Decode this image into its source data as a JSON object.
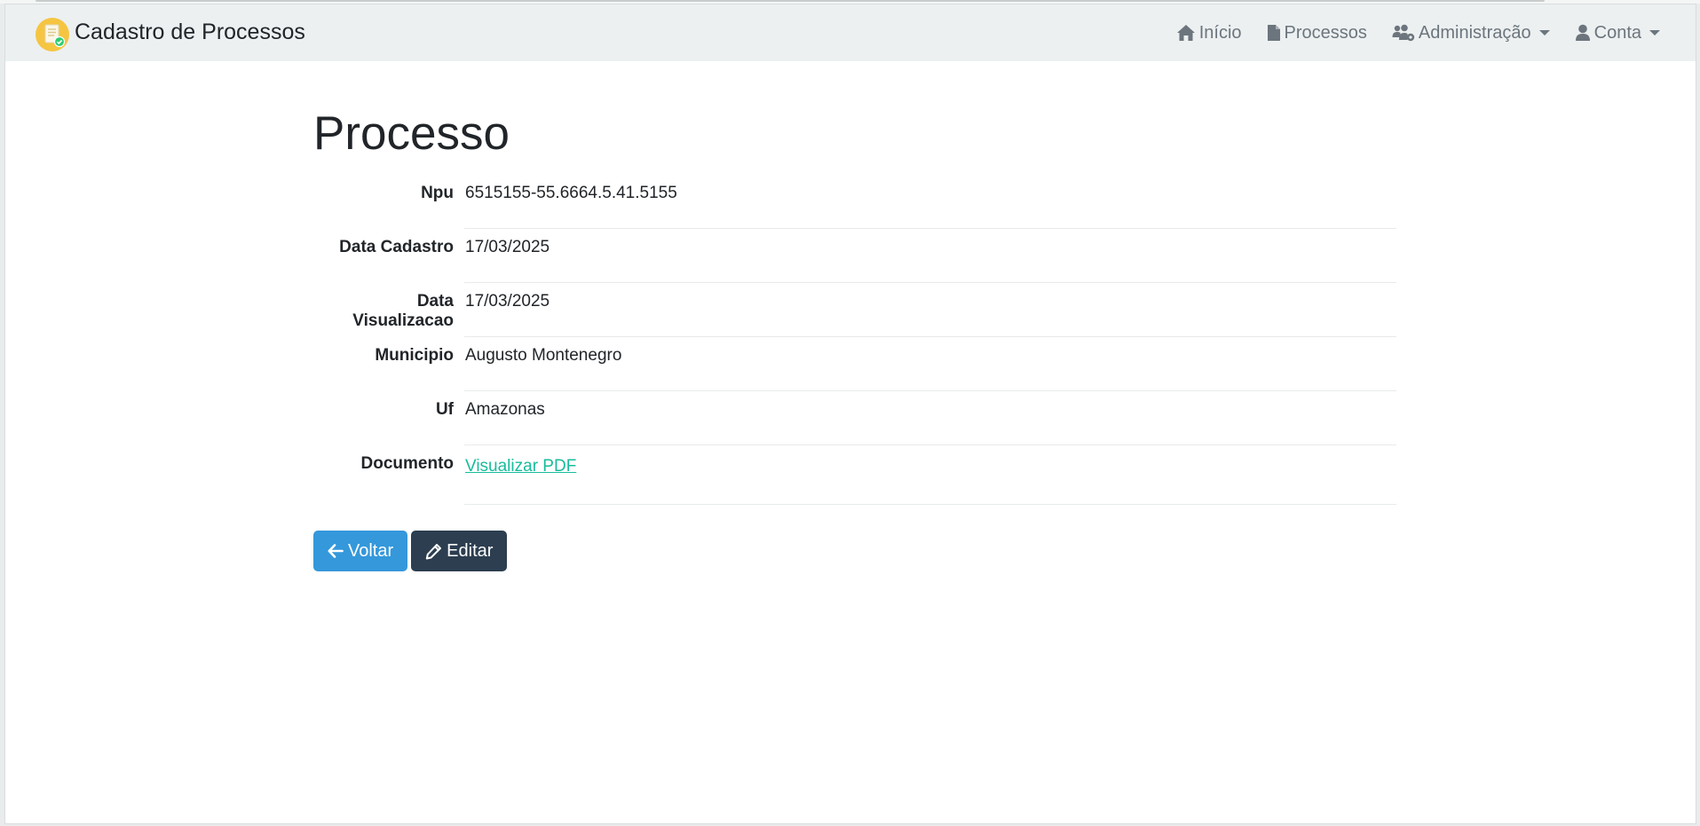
{
  "navbar": {
    "brand_title": "Cadastro de Processos",
    "items": [
      {
        "label": "Início",
        "icon": "home-icon",
        "dropdown": false
      },
      {
        "label": "Processos",
        "icon": "file-icon",
        "dropdown": false
      },
      {
        "label": "Administração",
        "icon": "users-cog-icon",
        "dropdown": true
      },
      {
        "label": "Conta",
        "icon": "user-icon",
        "dropdown": true
      }
    ]
  },
  "page": {
    "title": "Processo"
  },
  "details": {
    "npu_label": "Npu",
    "npu_value": "6515155-55.6664.5.41.5155",
    "data_cadastro_label": "Data Cadastro",
    "data_cadastro_value": "17/03/2025",
    "data_visualizacao_label": "Data Visualizacao",
    "data_visualizacao_value": "17/03/2025",
    "municipio_label": "Municipio",
    "municipio_value": "Augusto Montenegro",
    "uf_label": "Uf",
    "uf_value": "Amazonas",
    "documento_label": "Documento",
    "documento_link": "Visualizar PDF"
  },
  "actions": {
    "back_label": "Voltar",
    "edit_label": "Editar"
  },
  "colors": {
    "navbar_bg": "#ecf0f1",
    "primary": "#3498db",
    "dark": "#2c3e50",
    "link": "#18bc9c",
    "nav_text": "#6c757d"
  }
}
